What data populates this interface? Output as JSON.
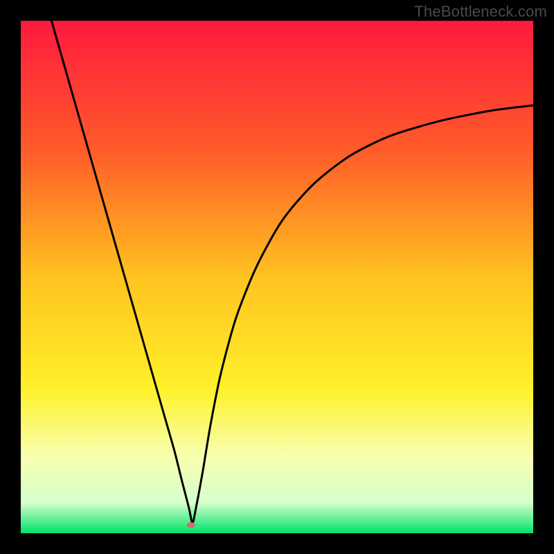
{
  "watermark": "TheBottleneck.com",
  "chart_data": {
    "type": "line",
    "title": "",
    "xlabel": "",
    "ylabel": "",
    "xlim": [
      0,
      100
    ],
    "ylim": [
      0,
      100
    ],
    "background_gradient": {
      "stops": [
        {
          "offset": 0.0,
          "color": "#ff1a3e"
        },
        {
          "offset": 0.25,
          "color": "#ff5a2a"
        },
        {
          "offset": 0.5,
          "color": "#ffc31f"
        },
        {
          "offset": 0.72,
          "color": "#fff12a"
        },
        {
          "offset": 0.85,
          "color": "#f8ffb0"
        },
        {
          "offset": 0.94,
          "color": "#d6ffcc"
        },
        {
          "offset": 1.0,
          "color": "#00e36b"
        }
      ]
    },
    "series": [
      {
        "name": "bottleneck-curve",
        "color": "#000000",
        "stroke_width": 3,
        "x": [
          6.0,
          10.0,
          14.0,
          18.0,
          22.0,
          26.0,
          28.0,
          30.0,
          31.5,
          32.8,
          33.5,
          34.2,
          35.5,
          37.0,
          39.0,
          42.0,
          46.0,
          51.0,
          57.0,
          64.0,
          72.0,
          82.0,
          92.0,
          100.0
        ],
        "y": [
          100.0,
          86.0,
          72.0,
          58.0,
          44.0,
          30.0,
          23.0,
          16.0,
          10.0,
          5.0,
          2.0,
          5.0,
          12.0,
          21.0,
          31.0,
          42.0,
          52.0,
          61.0,
          68.0,
          73.5,
          77.5,
          80.5,
          82.5,
          83.5
        ]
      }
    ],
    "marker": {
      "name": "min-point",
      "x": 33.2,
      "y": 1.6,
      "rx": 6,
      "ry": 4,
      "color": "#cf6f6f"
    }
  }
}
